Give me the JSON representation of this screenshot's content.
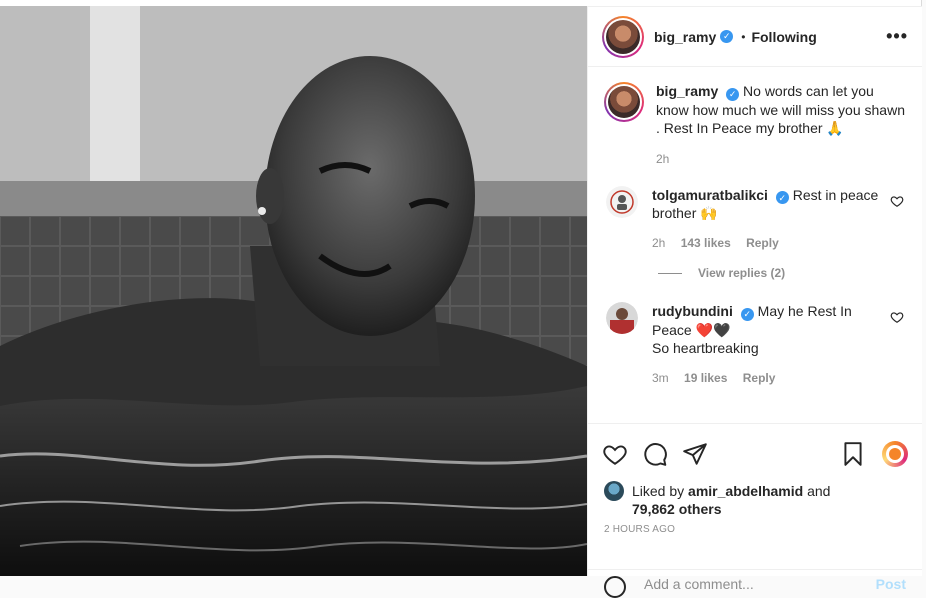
{
  "post": {
    "author": "big_ramy",
    "follow_status": "Following",
    "separator": "•",
    "more_label": "•••"
  },
  "caption": {
    "username": "big_ramy",
    "text": "No words can let you know how much we will miss you shawn . Rest In Peace my brother 🙏",
    "time": "2h"
  },
  "comments": [
    {
      "username": "tolgamuratbalikci",
      "text": "Rest in peace brother 🙌",
      "time": "2h",
      "likes": "143 likes",
      "reply": "Reply",
      "view_replies": "View replies (2)"
    },
    {
      "username": "rudybundini",
      "text": "May he Rest In Peace ❤️🖤",
      "text2": "So heartbreaking",
      "time": "3m",
      "likes": "19 likes",
      "reply": "Reply"
    }
  ],
  "likes_info": {
    "prefix": "Liked by",
    "user": "amir_abdelhamid",
    "and": "and",
    "count": "79,862 others"
  },
  "timestamp": "2 HOURS AGO",
  "add_comment": {
    "placeholder": "Add a comment...",
    "post_label": "Post"
  },
  "icons": {
    "verified": "verified-badge-icon",
    "like": "heart-icon",
    "comment": "comment-bubble-icon",
    "share": "paper-plane-icon",
    "save": "bookmark-icon",
    "extra": "instagram-ring-icon",
    "more": "more-options-icon"
  },
  "colors": {
    "verified": "#3897f0",
    "muted": "#8e8e8e",
    "text": "#262626",
    "post_button": "#b2dffc"
  }
}
